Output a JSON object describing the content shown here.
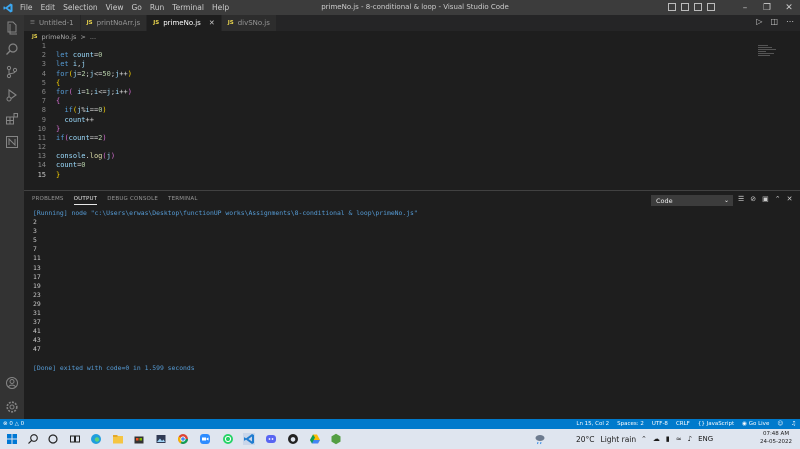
{
  "titlebar": {
    "menu": [
      "File",
      "Edit",
      "Selection",
      "View",
      "Go",
      "Run",
      "Terminal",
      "Help"
    ],
    "title": "primeNo.js - 8-conditional & loop - Visual Studio Code"
  },
  "tabs": [
    {
      "label": "Untitled-1",
      "icon": "file-icon",
      "badge": ""
    },
    {
      "label": "printNoArr.js",
      "icon": "js-icon",
      "badge": "JS"
    },
    {
      "label": "primeNo.js",
      "icon": "js-icon",
      "badge": "JS",
      "active": true
    },
    {
      "label": "divSNo.js",
      "icon": "js-icon",
      "badge": "JS"
    }
  ],
  "breadcrumb": {
    "badge": "JS",
    "file": "primeNo.js",
    "sep": ">",
    "rest": "..."
  },
  "editor": {
    "line_numbers": [
      "1",
      "2",
      "3",
      "4",
      "5",
      "6",
      "7",
      "8",
      "9",
      "10",
      "11",
      "12",
      "13",
      "14",
      "15"
    ],
    "current_line": 15
  },
  "panel": {
    "tabs": [
      "PROBLEMS",
      "OUTPUT",
      "DEBUG CONSOLE",
      "TERMINAL"
    ],
    "active_tab": "OUTPUT",
    "channel": "Code",
    "running_line": "[Running] node \"c:\\Users\\erwas\\Desktop\\functionUP works\\Assignments\\8-conditional & loop\\primeNo.js\"",
    "output_numbers": [
      "2",
      "3",
      "5",
      "7",
      "11",
      "13",
      "17",
      "19",
      "23",
      "29",
      "31",
      "37",
      "41",
      "43",
      "47"
    ],
    "done_line": "[Done] exited with code=0 in 1.599 seconds"
  },
  "statusbar": {
    "errors": "0",
    "warnings": "0",
    "position": "Ln 15, Col 2",
    "spaces": "Spaces: 2",
    "encoding": "UTF-8",
    "eol": "CRLF",
    "language": "JavaScript",
    "golive": "Go Live"
  },
  "taskbar": {
    "weather_temp": "20°C",
    "weather_desc": "Light rain",
    "lang": "ENG",
    "time": "07:48 AM",
    "date": "24-05-2022"
  },
  "colors": {
    "accent": "#007acc",
    "keyword": "#569cd6",
    "variable": "#9cdcfe",
    "number": "#b5cea8",
    "function": "#dcdcaa",
    "js_badge": "#e8d44d"
  }
}
